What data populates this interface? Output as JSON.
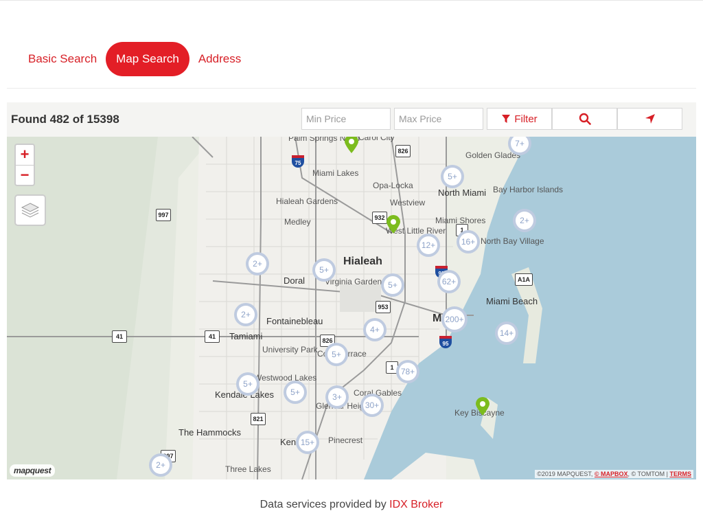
{
  "tabs": [
    {
      "label": "Basic Search",
      "active": false
    },
    {
      "label": "Map Search",
      "active": true
    },
    {
      "label": "Address",
      "active": false
    }
  ],
  "results": {
    "text": "Found 482 of 15398"
  },
  "filters": {
    "min_price_placeholder": "Min Price",
    "max_price_placeholder": "Max Price",
    "filter_label": "Filter"
  },
  "map": {
    "zoom_in": "+",
    "zoom_out": "−",
    "clusters": [
      "7+",
      "5+",
      "2+",
      "12+",
      "16+",
      "2+",
      "5+",
      "5+",
      "62+",
      "2+",
      "200+",
      "4+",
      "14+",
      "5+",
      "78+",
      "5+",
      "5+",
      "3+",
      "30+",
      "15+",
      "2+"
    ],
    "places": [
      "Palm Springs North",
      "Carol City",
      "Golden Glades",
      "Miami Lakes",
      "Opa-Locka",
      "North Miami",
      "Bay Harbor Islands",
      "Hialeah Gardens",
      "Westview",
      "Medley",
      "Miami Shores",
      "West Little River",
      "North Bay Village",
      "Hialeah",
      "Doral",
      "Virginia Gardens",
      "Miami Beach",
      "Fontainebleau",
      "Miami",
      "Tamiami",
      "University Park",
      "Coral Terrace",
      "Westwood Lakes",
      "Kendale Lakes",
      "Coral Gables",
      "Glenvar Heights",
      "Key Biscayne",
      "The Hammocks",
      "Kendall",
      "Pinecrest",
      "Three Lakes"
    ],
    "shields": [
      "75",
      "826",
      "997",
      "932",
      "953",
      "41",
      "41",
      "826",
      "821",
      "A1A",
      "95",
      "95",
      "1",
      "1",
      "997"
    ],
    "logo": "mapquest",
    "attribution": {
      "prefix": "©2019 MAPQUEST, ",
      "mapbox": "© MAPBOX",
      "middle": ", © TOMTOM | ",
      "terms": "TERMS"
    }
  },
  "colors": {
    "accent": "#e31e26",
    "water": "#a9c9d9",
    "cluster": "#aabad6",
    "pin": "#7cbc1e"
  },
  "footer": {
    "prefix": "Data services provided by ",
    "link": "IDX Broker"
  }
}
